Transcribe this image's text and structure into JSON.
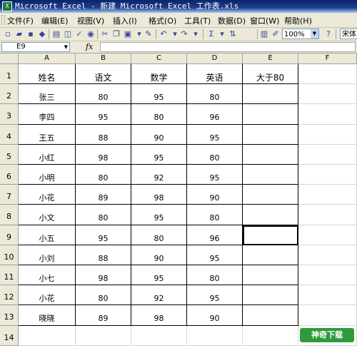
{
  "window": {
    "title": "Microsoft Excel - 新建 Microsoft Excel 工作表.xls"
  },
  "menu": [
    "文件(F)",
    "编辑(E)",
    "视图(V)",
    "插入(I)",
    "格式(O)",
    "工具(T)",
    "数据(D)",
    "窗口(W)",
    "帮助(H)"
  ],
  "toolbar": {
    "zoom": "100%",
    "font": "宋体",
    "sum_symbol": "Σ"
  },
  "formula_bar": {
    "name_box": "E9",
    "fx_label": "fx",
    "value": ""
  },
  "columns": [
    "A",
    "B",
    "C",
    "D",
    "E",
    "F"
  ],
  "row_numbers": [
    "1",
    "2",
    "3",
    "4",
    "5",
    "6",
    "7",
    "8",
    "9",
    "10",
    "11",
    "12",
    "13",
    "14"
  ],
  "headers": [
    "姓名",
    "语文",
    "数学",
    "英语",
    "大于80"
  ],
  "rows": [
    [
      "张三",
      "80",
      "95",
      "80"
    ],
    [
      "李四",
      "95",
      "80",
      "96"
    ],
    [
      "王五",
      "88",
      "90",
      "95"
    ],
    [
      "小红",
      "98",
      "95",
      "80"
    ],
    [
      "小明",
      "80",
      "92",
      "95"
    ],
    [
      "小花",
      "89",
      "98",
      "90"
    ],
    [
      "小文",
      "80",
      "95",
      "80"
    ],
    [
      "小五",
      "95",
      "80",
      "96"
    ],
    [
      "小刘",
      "88",
      "90",
      "95"
    ],
    [
      "小七",
      "98",
      "95",
      "80"
    ],
    [
      "小花",
      "80",
      "92",
      "95"
    ],
    [
      "晓晓",
      "89",
      "98",
      "90"
    ]
  ],
  "watermark": "神奇下载"
}
